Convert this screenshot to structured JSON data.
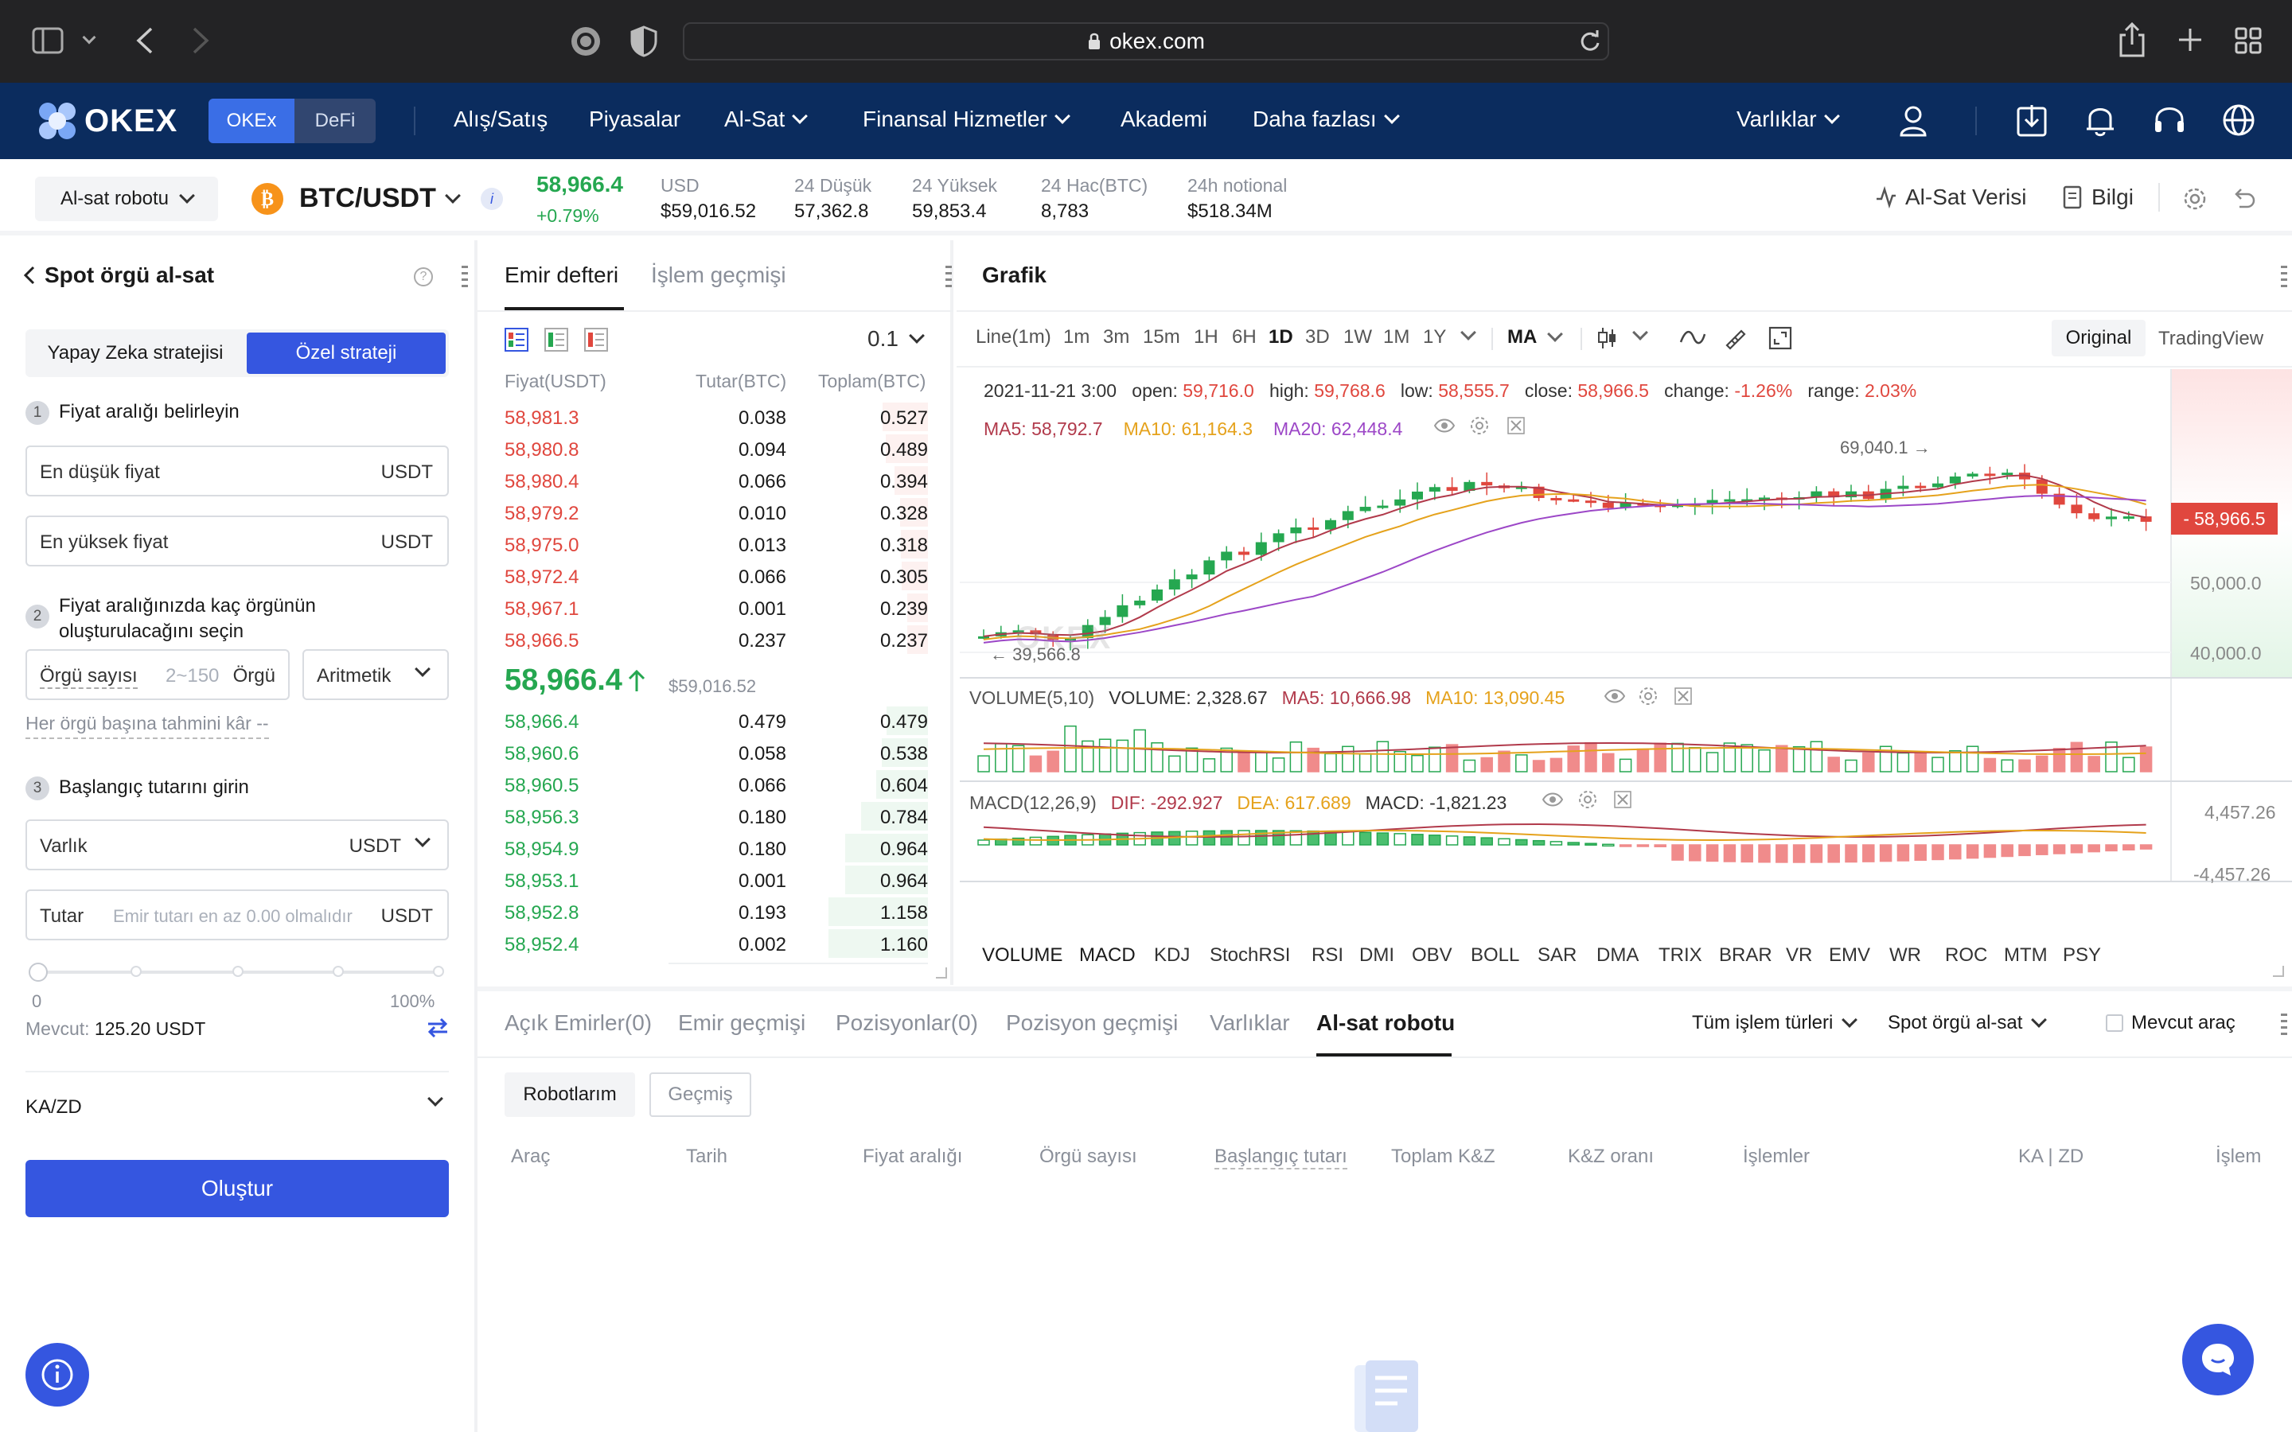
{
  "browser": {
    "url": "okex.com"
  },
  "nav": {
    "logo": "OKEX",
    "seg": [
      "OKEx",
      "DeFi"
    ],
    "items": [
      "Alış/Satış",
      "Piyasalar",
      "Al-Sat",
      "Finansal Hizmetler",
      "Akademi",
      "Daha fazlası"
    ],
    "assets": "Varlıklar"
  },
  "ticker": {
    "bot": "Al-sat robotu",
    "pair": "BTC/USDT",
    "price": "58,966.4",
    "change": "+0.79%",
    "stats": [
      {
        "label": "USD",
        "value": "$59,016.52"
      },
      {
        "label": "24 Düşük",
        "value": "57,362.8"
      },
      {
        "label": "24 Yüksek",
        "value": "59,853.4"
      },
      {
        "label": "24 Hac(BTC)",
        "value": "8,783"
      },
      {
        "label": "24h notional",
        "value": "$518.34M"
      }
    ],
    "data_link": "Al-Sat Verisi",
    "info_link": "Bilgi"
  },
  "left": {
    "title": "Spot örgü al-sat",
    "tabs": [
      "Yapay Zeka stratejisi",
      "Özel strateji"
    ],
    "step1": "Fiyat aralığı belirleyin",
    "low_ph": "En düşük fiyat",
    "high_ph": "En yüksek fiyat",
    "unit": "USDT",
    "step2": "Fiyat aralığınızda kaç örgünün oluşturulacağını seçin",
    "grid_label": "Örgü sayısı",
    "grid_range": "2~150",
    "grid_unit": "Örgü",
    "grid_mode": "Aritmetik",
    "profit": "Her örgü başına tahmini kâr --",
    "step3": "Başlangıç tutarını girin",
    "asset_label": "Varlık",
    "amount_label": "Tutar",
    "amount_ph": "Emir tutarı en az 0.00 olmalıdır",
    "slider_min": "0",
    "slider_max": "100%",
    "available_label": "Mevcut:",
    "available_value": "125.20 USDT",
    "tpsl": "KA/ZD",
    "create": "Oluştur"
  },
  "book": {
    "tabs": [
      "Emir defteri",
      "İşlem geçmişi"
    ],
    "precision": "0.1",
    "headers": [
      "Fiyat(USDT)",
      "Tutar(BTC)",
      "Toplam(BTC)"
    ],
    "asks": [
      [
        "58,981.3",
        "0.038",
        "0.527"
      ],
      [
        "58,980.8",
        "0.094",
        "0.489"
      ],
      [
        "58,980.4",
        "0.066",
        "0.394"
      ],
      [
        "58,979.2",
        "0.010",
        "0.328"
      ],
      [
        "58,975.0",
        "0.013",
        "0.318"
      ],
      [
        "58,972.4",
        "0.066",
        "0.305"
      ],
      [
        "58,967.1",
        "0.001",
        "0.239"
      ],
      [
        "58,966.5",
        "0.237",
        "0.237"
      ]
    ],
    "last_price": "58,966.4",
    "last_usd": "$59,016.52",
    "bids": [
      [
        "58,966.4",
        "0.479",
        "0.479"
      ],
      [
        "58,960.6",
        "0.058",
        "0.538"
      ],
      [
        "58,960.5",
        "0.066",
        "0.604"
      ],
      [
        "58,956.3",
        "0.180",
        "0.784"
      ],
      [
        "58,954.9",
        "0.180",
        "0.964"
      ],
      [
        "58,953.1",
        "0.001",
        "0.964"
      ],
      [
        "58,952.8",
        "0.193",
        "1.158"
      ],
      [
        "58,952.4",
        "0.002",
        "1.160"
      ]
    ]
  },
  "chart": {
    "title": "Grafik",
    "intervals": [
      "Line(1m)",
      "1m",
      "3m",
      "15m",
      "1H",
      "6H",
      "1D",
      "3D",
      "1W",
      "1M",
      "1Y"
    ],
    "ma_btn": "MA",
    "views": [
      "Original",
      "TradingView"
    ],
    "ohlc": {
      "date": "2021-11-21 3:00",
      "open_l": "open:",
      "open": "59,716.0",
      "high_l": "high:",
      "high": "59,768.6",
      "low_l": "low:",
      "low": "58,555.7",
      "close_l": "close:",
      "close": "58,966.5",
      "change_l": "change:",
      "change": "-1.26%",
      "range_l": "range:",
      "range": "2.03%"
    },
    "ma": {
      "ma5": "MA5: 58,792.7",
      "ma10": "MA10: 61,164.3",
      "ma20": "MA20: 62,448.4"
    },
    "marker_high": "69,040.1",
    "marker_low": "39,566.8",
    "price_tag": "58,966.5",
    "y_ticks": [
      "50,000.0",
      "40,000.0"
    ],
    "volume": {
      "title": "VOLUME(5,10)",
      "vol": "VOLUME: 2,328.67",
      "ma5": "MA5: 10,666.98",
      "ma10": "MA10: 13,090.45"
    },
    "macd": {
      "title": "MACD(12,26,9)",
      "dif": "DIF: -292.927",
      "dea": "DEA: 617.689",
      "macd": "MACD: -1,821.23",
      "y_top": "4,457.26",
      "y_bot": "-4,457.26"
    },
    "indicators": [
      "VOLUME",
      "MACD",
      "KDJ",
      "StochRSI",
      "RSI",
      "DMI",
      "OBV",
      "BOLL",
      "SAR",
      "DMA",
      "TRIX",
      "BRAR",
      "VR",
      "EMV",
      "WR",
      "ROC",
      "MTM",
      "PSY"
    ],
    "watermark": "OKEX"
  },
  "bottom": {
    "tabs": [
      "Açık Emirler(0)",
      "Emir geçmişi",
      "Pozisyonlar(0)",
      "Pozisyon geçmişi",
      "Varlıklar",
      "Al-sat robotu"
    ],
    "filter1": "Tüm işlem türleri",
    "filter2": "Spot örgü al-sat",
    "filter3": "Mevcut araç",
    "subtabs": [
      "Robotlarım",
      "Geçmiş"
    ],
    "headers": [
      "Araç",
      "Tarih",
      "Fiyat aralığı",
      "Örgü sayısı",
      "Başlangıç tutarı",
      "Toplam K&Z",
      "K&Z oranı",
      "İşlemler",
      "KA | ZD",
      "İşlem"
    ]
  },
  "colors": {
    "green": "#25a750",
    "red": "#e0473e",
    "blue": "#3556e0",
    "nav": "#0b2c5e"
  }
}
